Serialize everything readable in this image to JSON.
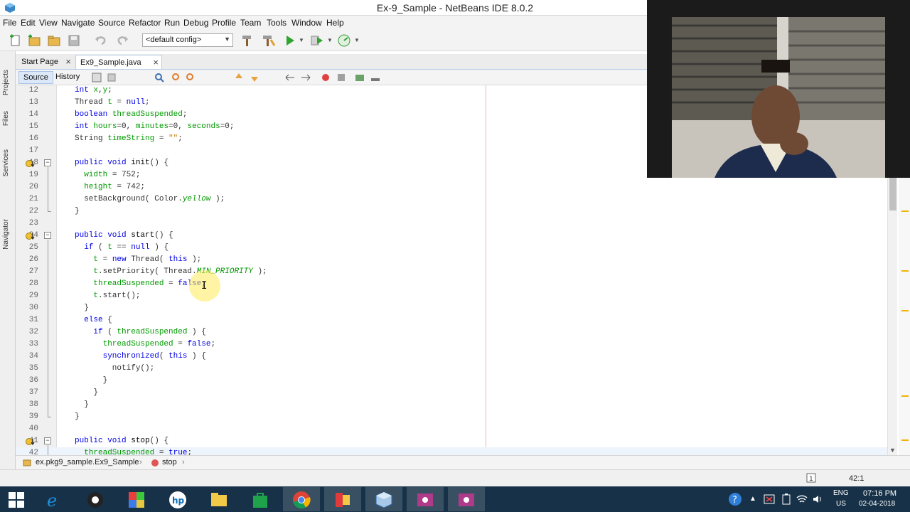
{
  "window": {
    "title": "Ex-9_Sample - NetBeans IDE 8.0.2",
    "close_glyph": "✕"
  },
  "menubar": {
    "items": [
      {
        "label": "File"
      },
      {
        "label": "Edit"
      },
      {
        "label": "View"
      },
      {
        "label": "Navigate"
      },
      {
        "label": "Source"
      },
      {
        "label": "Refactor"
      },
      {
        "label": "Run"
      },
      {
        "label": "Debug"
      },
      {
        "label": "Profile"
      },
      {
        "label": "Team"
      },
      {
        "label": "Tools"
      },
      {
        "label": "Window"
      },
      {
        "label": "Help"
      }
    ]
  },
  "toolbar": {
    "config_value": "<default config>"
  },
  "side_panels": [
    "Projects",
    "Files",
    "Services",
    "Navigator"
  ],
  "tabs": [
    {
      "label": "Start Page",
      "active": false
    },
    {
      "label": "Ex9_Sample.java",
      "active": true
    }
  ],
  "editor_toolbar": {
    "source_label": "Source",
    "history_label": "History"
  },
  "code": {
    "lines": [
      {
        "n": "12",
        "segments": [
          [
            "k",
            "int"
          ],
          [
            "p",
            " "
          ],
          [
            "f",
            "x"
          ],
          [
            "p",
            ","
          ],
          [
            "f",
            "y"
          ],
          [
            "p",
            ";"
          ]
        ]
      },
      {
        "n": "13",
        "segments": [
          [
            "p",
            "Thread "
          ],
          [
            "f",
            "t"
          ],
          [
            "p",
            " = "
          ],
          [
            "k",
            "null"
          ],
          [
            "p",
            ";"
          ]
        ]
      },
      {
        "n": "14",
        "segments": [
          [
            "k",
            "boolean"
          ],
          [
            "p",
            " "
          ],
          [
            "f",
            "threadSuspended"
          ],
          [
            "p",
            ";"
          ]
        ]
      },
      {
        "n": "15",
        "segments": [
          [
            "k",
            "int"
          ],
          [
            "p",
            " "
          ],
          [
            "f",
            "hours"
          ],
          [
            "p",
            "=0, "
          ],
          [
            "f",
            "minutes"
          ],
          [
            "p",
            "=0, "
          ],
          [
            "f",
            "seconds"
          ],
          [
            "p",
            "=0;"
          ]
        ]
      },
      {
        "n": "16",
        "segments": [
          [
            "p",
            "String "
          ],
          [
            "f",
            "timeString"
          ],
          [
            "p",
            " = "
          ],
          [
            "s",
            "\"\""
          ],
          [
            "p",
            ";"
          ]
        ]
      },
      {
        "n": "17",
        "segments": []
      },
      {
        "n": "18",
        "segments": [
          [
            "k",
            "public void"
          ],
          [
            "p",
            " "
          ],
          [
            "m",
            "init"
          ],
          [
            "p",
            "() {"
          ]
        ]
      },
      {
        "n": "19",
        "segments": [
          [
            "p",
            "  "
          ],
          [
            "f",
            "width"
          ],
          [
            "p",
            " = 752;"
          ]
        ]
      },
      {
        "n": "20",
        "segments": [
          [
            "p",
            "  "
          ],
          [
            "f",
            "height"
          ],
          [
            "p",
            " = 742;"
          ]
        ]
      },
      {
        "n": "21",
        "segments": [
          [
            "p",
            "  setBackground( Color."
          ],
          [
            "i",
            "yellow"
          ],
          [
            "p",
            " );"
          ]
        ]
      },
      {
        "n": "22",
        "segments": [
          [
            "p",
            "}"
          ]
        ]
      },
      {
        "n": "23",
        "segments": []
      },
      {
        "n": "24",
        "segments": [
          [
            "k",
            "public void"
          ],
          [
            "p",
            " "
          ],
          [
            "m",
            "start"
          ],
          [
            "p",
            "() {"
          ]
        ]
      },
      {
        "n": "25",
        "segments": [
          [
            "p",
            "  "
          ],
          [
            "k",
            "if"
          ],
          [
            "p",
            " ( "
          ],
          [
            "f",
            "t"
          ],
          [
            "p",
            " == "
          ],
          [
            "k",
            "null"
          ],
          [
            "p",
            " ) {"
          ]
        ]
      },
      {
        "n": "26",
        "segments": [
          [
            "p",
            "    "
          ],
          [
            "f",
            "t"
          ],
          [
            "p",
            " = "
          ],
          [
            "k",
            "new"
          ],
          [
            "p",
            " Thread( "
          ],
          [
            "k",
            "this"
          ],
          [
            "p",
            " );"
          ]
        ]
      },
      {
        "n": "27",
        "segments": [
          [
            "p",
            "    "
          ],
          [
            "f",
            "t"
          ],
          [
            "p",
            ".setPriority( Thread."
          ],
          [
            "i",
            "MIN_PRIORITY"
          ],
          [
            "p",
            " );"
          ]
        ]
      },
      {
        "n": "28",
        "segments": [
          [
            "p",
            "    "
          ],
          [
            "f",
            "threadSuspended"
          ],
          [
            "p",
            " = "
          ],
          [
            "k",
            "false"
          ],
          [
            "p",
            ";"
          ]
        ]
      },
      {
        "n": "29",
        "segments": [
          [
            "p",
            "    "
          ],
          [
            "f",
            "t"
          ],
          [
            "p",
            ".start();"
          ]
        ]
      },
      {
        "n": "30",
        "segments": [
          [
            "p",
            "  }"
          ]
        ]
      },
      {
        "n": "31",
        "segments": [
          [
            "p",
            "  "
          ],
          [
            "k",
            "else"
          ],
          [
            "p",
            " {"
          ]
        ]
      },
      {
        "n": "32",
        "segments": [
          [
            "p",
            "    "
          ],
          [
            "k",
            "if"
          ],
          [
            "p",
            " ( "
          ],
          [
            "f",
            "threadSuspended"
          ],
          [
            "p",
            " ) {"
          ]
        ]
      },
      {
        "n": "33",
        "segments": [
          [
            "p",
            "      "
          ],
          [
            "f",
            "threadSuspended"
          ],
          [
            "p",
            " = "
          ],
          [
            "k",
            "false"
          ],
          [
            "p",
            ";"
          ]
        ]
      },
      {
        "n": "34",
        "segments": [
          [
            "p",
            "      "
          ],
          [
            "k",
            "synchronized"
          ],
          [
            "p",
            "( "
          ],
          [
            "k",
            "this"
          ],
          [
            "p",
            " ) {"
          ]
        ]
      },
      {
        "n": "35",
        "segments": [
          [
            "p",
            "        notify();"
          ]
        ]
      },
      {
        "n": "36",
        "segments": [
          [
            "p",
            "      }"
          ]
        ]
      },
      {
        "n": "37",
        "segments": [
          [
            "p",
            "    }"
          ]
        ]
      },
      {
        "n": "38",
        "segments": [
          [
            "p",
            "  }"
          ]
        ]
      },
      {
        "n": "39",
        "segments": [
          [
            "p",
            "}"
          ]
        ]
      },
      {
        "n": "40",
        "segments": []
      },
      {
        "n": "41",
        "segments": [
          [
            "k",
            "public void"
          ],
          [
            "p",
            " "
          ],
          [
            "m",
            "stop"
          ],
          [
            "p",
            "() {"
          ]
        ]
      },
      {
        "n": "42",
        "segments": [
          [
            "p",
            "  "
          ],
          [
            "f",
            "threadSuspended"
          ],
          [
            "p",
            " = "
          ],
          [
            "k",
            "true"
          ],
          [
            "p",
            ";"
          ]
        ]
      }
    ]
  },
  "breadcrumbs": {
    "package_class": "ex.pkg9_sample.Ex9_Sample",
    "method": "stop"
  },
  "status": {
    "caret_position": "42:1"
  },
  "taskbar": {
    "lang": "ENG",
    "region": "US",
    "time": "07:16 PM",
    "date": "02-04-2018"
  },
  "colors": {
    "keyword": "#000080",
    "field": "#009900",
    "string": "#ce7b00",
    "taskbar": "#173248"
  }
}
